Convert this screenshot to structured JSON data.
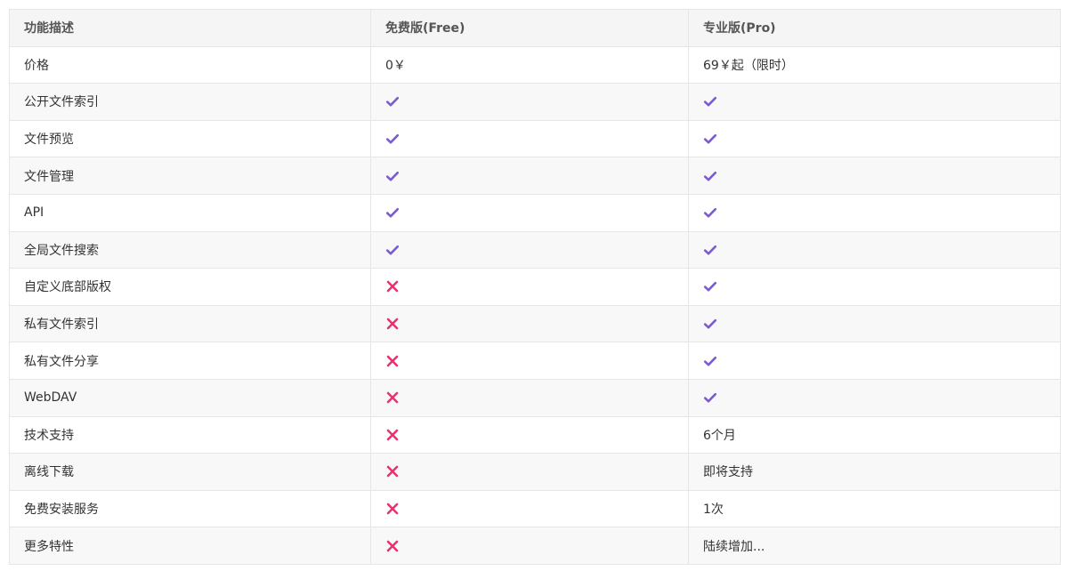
{
  "table": {
    "headers": [
      "功能描述",
      "免费版(Free)",
      "专业版(Pro)"
    ],
    "rows": [
      {
        "feature": "价格",
        "free": {
          "type": "text",
          "text": "0￥"
        },
        "pro": {
          "type": "text",
          "text": "69￥起（限时）"
        }
      },
      {
        "feature": "公开文件索引",
        "free": {
          "type": "check"
        },
        "pro": {
          "type": "check"
        }
      },
      {
        "feature": "文件预览",
        "free": {
          "type": "check"
        },
        "pro": {
          "type": "check"
        }
      },
      {
        "feature": "文件管理",
        "free": {
          "type": "check"
        },
        "pro": {
          "type": "check"
        }
      },
      {
        "feature": "API",
        "free": {
          "type": "check"
        },
        "pro": {
          "type": "check"
        }
      },
      {
        "feature": "全局文件搜索",
        "free": {
          "type": "check"
        },
        "pro": {
          "type": "check"
        }
      },
      {
        "feature": "自定义底部版权",
        "free": {
          "type": "cross"
        },
        "pro": {
          "type": "check"
        }
      },
      {
        "feature": "私有文件索引",
        "free": {
          "type": "cross"
        },
        "pro": {
          "type": "check"
        }
      },
      {
        "feature": "私有文件分享",
        "free": {
          "type": "cross"
        },
        "pro": {
          "type": "check"
        }
      },
      {
        "feature": "WebDAV",
        "free": {
          "type": "cross"
        },
        "pro": {
          "type": "check"
        }
      },
      {
        "feature": "技术支持",
        "free": {
          "type": "cross"
        },
        "pro": {
          "type": "text",
          "text": "6个月"
        }
      },
      {
        "feature": "离线下载",
        "free": {
          "type": "cross"
        },
        "pro": {
          "type": "text",
          "text": "即将支持"
        }
      },
      {
        "feature": "免费安装服务",
        "free": {
          "type": "cross"
        },
        "pro": {
          "type": "text",
          "text": "1次"
        }
      },
      {
        "feature": "更多特性",
        "free": {
          "type": "cross"
        },
        "pro": {
          "type": "text",
          "text": "陆续增加..."
        }
      }
    ]
  },
  "icons": {
    "check": "check-icon",
    "cross": "cross-icon"
  },
  "colors": {
    "check": "#7b5ccf",
    "cross": "#e8336d",
    "header_bg": "#f5f5f5",
    "stripe_bg": "#f8f8f8",
    "border": "#e6e6e6"
  }
}
